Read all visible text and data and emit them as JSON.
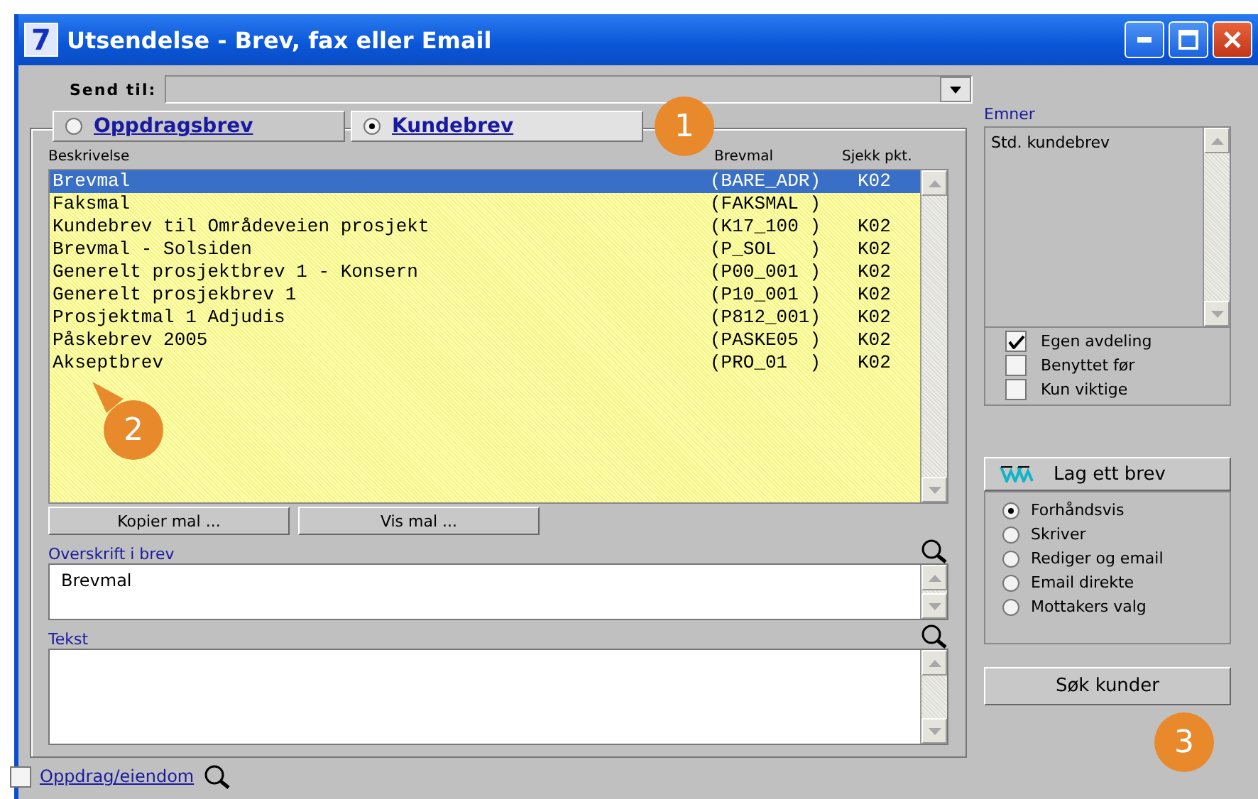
{
  "window": {
    "title": "Utsendelse - Brev, fax eller Email",
    "icon_text": "7"
  },
  "send_to": {
    "label": "Send til:"
  },
  "tabs": [
    {
      "label": "Oppdragsbrev",
      "selected": false
    },
    {
      "label": "Kundebrev",
      "selected": true
    }
  ],
  "list": {
    "columns": [
      "Beskrivelse",
      "Brevmal",
      "Sjekk pkt."
    ],
    "rows": [
      {
        "description": "Brevmal",
        "template": "(BARE_ADR)",
        "check": "K02",
        "selected": true
      },
      {
        "description": "Faksmal",
        "template": "(FAKSMAL )",
        "selected": false
      },
      {
        "description": "Kundebrev til Områdeveien prosjekt",
        "template": "(K17_100 )",
        "check": "K02",
        "selected": false
      },
      {
        "description": "Brevmal - Solsiden",
        "template": "(P_SOL   )",
        "check": "K02",
        "selected": false
      },
      {
        "description": "Generelt prosjektbrev 1 - Konsern",
        "template": "(P00_001 )",
        "check": "K02",
        "selected": false
      },
      {
        "description": "Generelt prosjekbrev 1",
        "template": "(P10_001 )",
        "check": "K02",
        "selected": false
      },
      {
        "description": "Prosjektmal 1 Adjudis",
        "template": "(P812_001)",
        "check": "K02",
        "selected": false
      },
      {
        "description": "Påskebrev 2005",
        "template": "(PASKE05 )",
        "check": "K02",
        "selected": false
      },
      {
        "description": "Akseptbrev",
        "template": "(PRO_01  )",
        "check": "K02",
        "selected": false
      }
    ]
  },
  "list_buttons": [
    "Kopier mal ...",
    "Vis mal ..."
  ],
  "heading_field": {
    "label": "Overskrift i brev",
    "value": "Brevmal"
  },
  "text_field": {
    "label": "Tekst"
  },
  "property_filter": {
    "label": "Oppdrag/eiendom",
    "checked": false
  },
  "topics": {
    "label": "Emner",
    "items": [
      "Std. kundebrev"
    ]
  },
  "filters": [
    {
      "label": "Egen avdeling",
      "checked": true
    },
    {
      "label": "Benyttet før",
      "checked": false
    },
    {
      "label": "Kun viktige",
      "checked": false
    }
  ],
  "make_letter": {
    "label": "Lag ett brev",
    "options": [
      {
        "label": "Forhåndsvis",
        "selected": true
      },
      {
        "label": "Skriver",
        "selected": false
      },
      {
        "label": "Rediger og email",
        "selected": false
      },
      {
        "label": "Email direkte",
        "selected": false
      },
      {
        "label": "Mottakers valg",
        "selected": false
      }
    ]
  },
  "search_button": "Søk kunder",
  "callouts": [
    "1",
    "2",
    "3"
  ]
}
